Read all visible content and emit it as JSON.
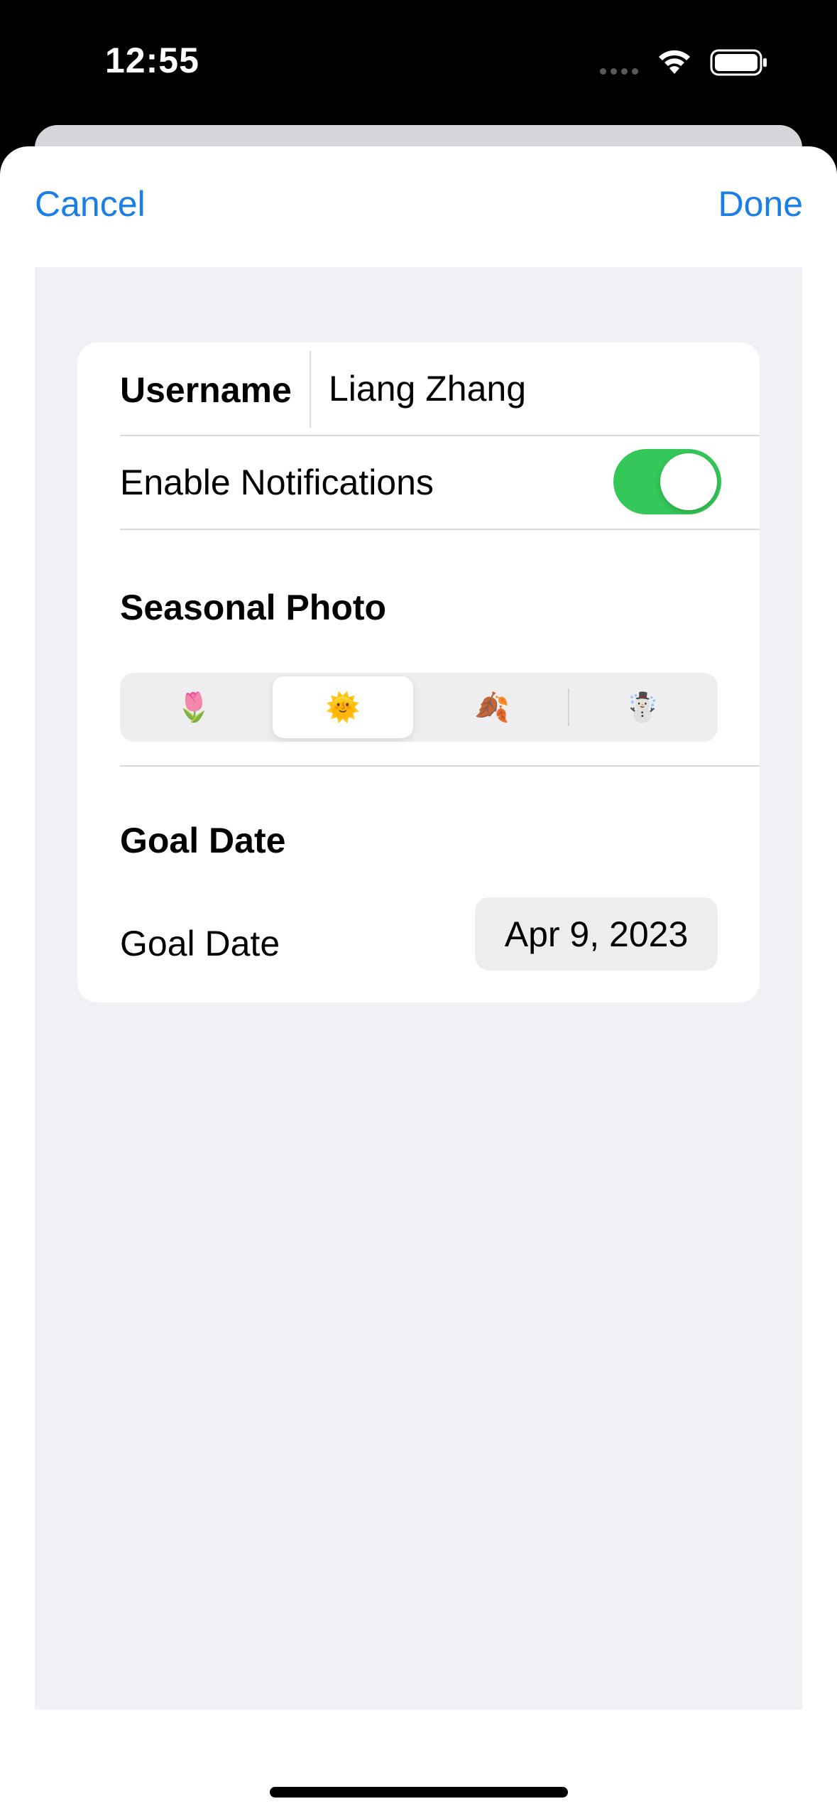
{
  "status_bar": {
    "time": "12:55",
    "icons": [
      "signal-dots-icon",
      "wifi-icon",
      "battery-icon"
    ]
  },
  "nav": {
    "cancel_label": "Cancel",
    "done_label": "Done"
  },
  "form": {
    "username": {
      "label": "Username",
      "value": "Liang Zhang"
    },
    "notifications": {
      "label": "Enable Notifications",
      "enabled": true
    },
    "seasonal_photo": {
      "heading": "Seasonal Photo",
      "options": [
        {
          "icon": "tulip-icon",
          "glyph": "🌷",
          "selected": false
        },
        {
          "icon": "sun-icon",
          "glyph": "🌞",
          "selected": true
        },
        {
          "icon": "fallen-leaves-icon",
          "glyph": "🍂",
          "selected": false
        },
        {
          "icon": "snowman-icon",
          "glyph": "☃️",
          "selected": false
        }
      ]
    },
    "goal_date": {
      "heading": "Goal Date",
      "label": "Goal Date",
      "value": "Apr 9, 2023"
    }
  },
  "colors": {
    "accent": "#1a7ee8",
    "toggle_on": "#34c759",
    "grouped_background": "#f1f1f5"
  }
}
